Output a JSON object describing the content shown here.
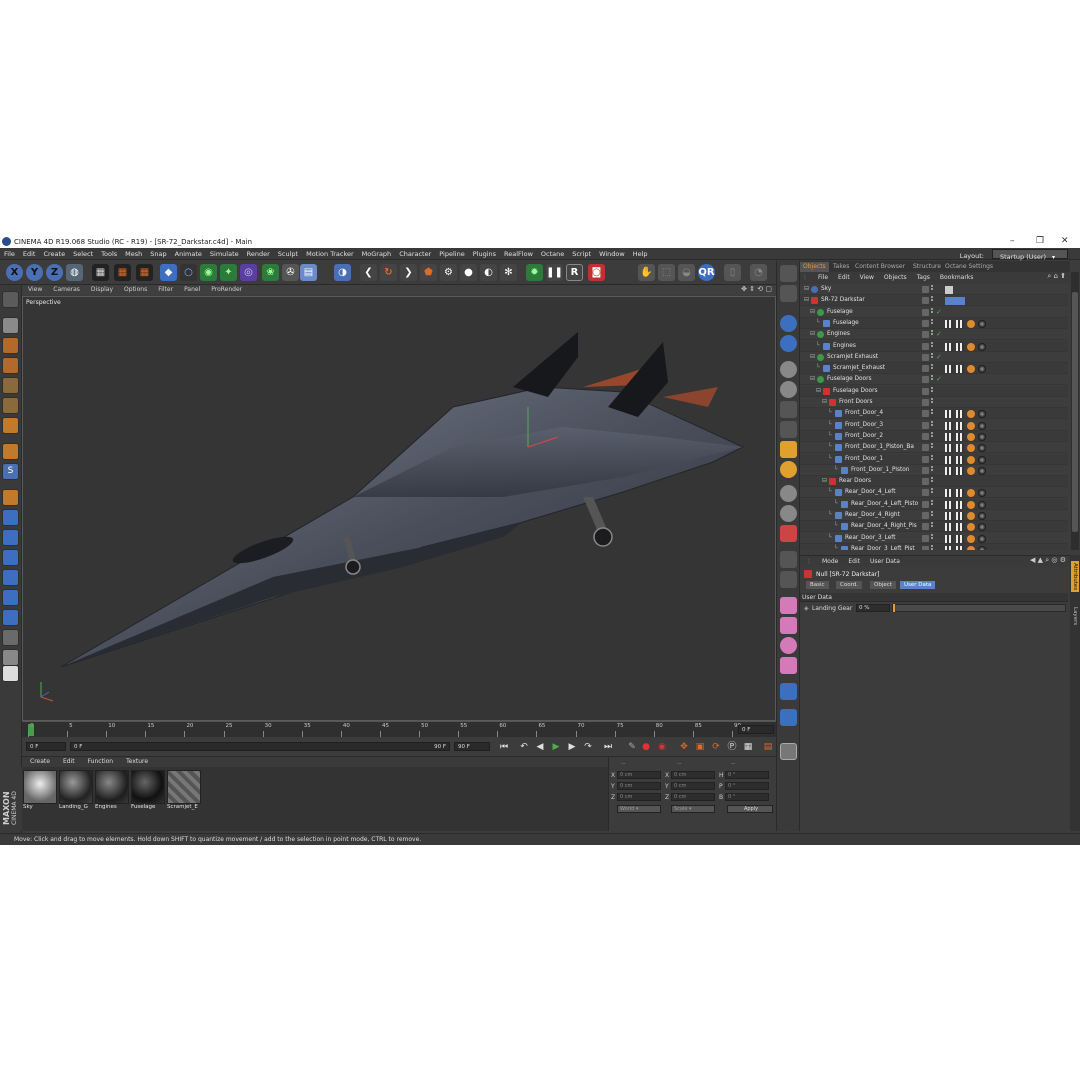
{
  "window": {
    "title": "CINEMA 4D R19.068 Studio (RC - R19) - [SR-72_Darkstar.c4d] - Main",
    "minimize": "–",
    "maximize": "❐",
    "close": "✕"
  },
  "menubar": [
    "File",
    "Edit",
    "Create",
    "Select",
    "Tools",
    "Mesh",
    "Snap",
    "Animate",
    "Simulate",
    "Render",
    "Sculpt",
    "Motion Tracker",
    "MoGraph",
    "Character",
    "Pipeline",
    "Plugins",
    "RealFlow",
    "Octane",
    "Script",
    "Window",
    "Help"
  ],
  "layout": {
    "label": "Layout:",
    "value": "Startup (User)"
  },
  "toolbar": {
    "x_label": "X",
    "y_label": "Y",
    "z_label": "Z"
  },
  "viewport": {
    "menu": [
      "View",
      "Cameras",
      "Display",
      "Options",
      "Filter",
      "Panel",
      "ProRender"
    ],
    "label": "Perspective"
  },
  "timeline": {
    "ticks": [
      "0",
      "5",
      "10",
      "15",
      "20",
      "25",
      "30",
      "35",
      "40",
      "45",
      "50",
      "55",
      "60",
      "65",
      "70",
      "75",
      "80",
      "85",
      "90"
    ],
    "end_frame_label": "0 F",
    "current_frame": "0 F",
    "start_field": "0 F",
    "preview_end": "90 F",
    "end_field": "90 F"
  },
  "materials": {
    "menu": [
      "Create",
      "Edit",
      "Function",
      "Texture"
    ],
    "items": [
      {
        "name": "Sky",
        "icon": "sky-material-icon"
      },
      {
        "name": "Landing_G",
        "icon": "landing-gear-material-icon"
      },
      {
        "name": "Engines",
        "icon": "engines-material-icon"
      },
      {
        "name": "Fuselage",
        "icon": "fuselage-material-icon"
      },
      {
        "name": "Scramjet_E",
        "icon": "scramjet-material-icon"
      }
    ]
  },
  "coordinates": {
    "header": [
      "--",
      "--",
      "--"
    ],
    "rows": [
      {
        "axis": "X",
        "pos": "0 cm",
        "axis2": "X",
        "size": "0 cm",
        "axis3": "H",
        "rot": "0 °"
      },
      {
        "axis": "Y",
        "pos": "0 cm",
        "axis2": "Y",
        "size": "0 cm",
        "axis3": "P",
        "rot": "0 °"
      },
      {
        "axis": "Z",
        "pos": "0 cm",
        "axis2": "Z",
        "size": "0 cm",
        "axis3": "B",
        "rot": "0 °"
      }
    ],
    "mode_select": "World",
    "scale_select": "Scale",
    "apply": "Apply"
  },
  "status": "Move: Click and drag to move elements. Hold down SHIFT to quantize movement / add to the selection in point mode, CTRL to remove.",
  "object_manager": {
    "tabs": [
      "Objects",
      "Takes",
      "Content Browser",
      "Structure",
      "Octane Settings"
    ],
    "menu": [
      "File",
      "Edit",
      "View",
      "Objects",
      "Tags",
      "Bookmarks"
    ],
    "rows": [
      {
        "name": "Sky",
        "indent": 0,
        "type": "sky"
      },
      {
        "name": "SR-72 Darkstar",
        "indent": 0,
        "type": "null"
      },
      {
        "name": "Fuselage",
        "indent": 1,
        "type": "symmetry"
      },
      {
        "name": "Fuselage",
        "indent": 2,
        "type": "poly"
      },
      {
        "name": "Engines",
        "indent": 1,
        "type": "symmetry"
      },
      {
        "name": "Engines",
        "indent": 2,
        "type": "poly"
      },
      {
        "name": "Scramjet Exhaust",
        "indent": 1,
        "type": "symmetry"
      },
      {
        "name": "Scramjet_Exhaust",
        "indent": 2,
        "type": "poly"
      },
      {
        "name": "Fuselage Doors",
        "indent": 1,
        "type": "symmetry"
      },
      {
        "name": "Fuselage Doors",
        "indent": 2,
        "type": "null"
      },
      {
        "name": "Front Doors",
        "indent": 3,
        "type": "null"
      },
      {
        "name": "Front_Door_4",
        "indent": 4,
        "type": "poly"
      },
      {
        "name": "Front_Door_3",
        "indent": 4,
        "type": "poly"
      },
      {
        "name": "Front_Door_2",
        "indent": 4,
        "type": "poly"
      },
      {
        "name": "Front_Door_1_Piston_Ba",
        "indent": 4,
        "type": "poly"
      },
      {
        "name": "Front_Door_1",
        "indent": 4,
        "type": "poly"
      },
      {
        "name": "Front_Door_1_Piston",
        "indent": 5,
        "type": "poly"
      },
      {
        "name": "Rear Doors",
        "indent": 3,
        "type": "null"
      },
      {
        "name": "Rear_Door_4_Left",
        "indent": 4,
        "type": "poly"
      },
      {
        "name": "Rear_Door_4_Left_Pisto",
        "indent": 5,
        "type": "poly"
      },
      {
        "name": "Rear_Door_4_Right",
        "indent": 4,
        "type": "poly"
      },
      {
        "name": "Rear_Door_4_Right_Pis",
        "indent": 5,
        "type": "poly"
      },
      {
        "name": "Rear_Door_3_Left",
        "indent": 4,
        "type": "poly"
      },
      {
        "name": "Rear_Door_3_Left_Pist",
        "indent": 5,
        "type": "poly"
      }
    ]
  },
  "attribute_manager": {
    "menu": [
      "Mode",
      "Edit",
      "User Data"
    ],
    "title": "Null [SR-72 Darkstar]",
    "tabs": [
      "Basic",
      "Coord.",
      "Object",
      "User Data"
    ],
    "active_tab": "User Data",
    "section": "User Data",
    "param_label": "Landing Gear",
    "param_value": "0 %",
    "param_fraction": 0.0,
    "side_tabs": [
      "Attributes",
      "Layers"
    ]
  },
  "colors": {
    "ui_bg": "#3c3c3c",
    "viewport_bg": "#353535",
    "accent_blue": "#4a6fb5",
    "active_tab": "#5b82c8",
    "orange": "#e06a24"
  }
}
